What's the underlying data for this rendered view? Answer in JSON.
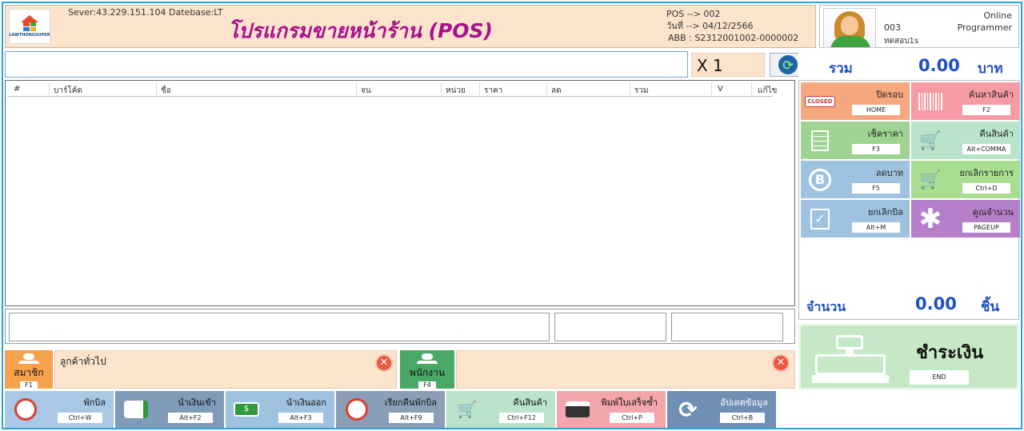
{
  "header": {
    "logo_text": "LAWTHONGSUPER",
    "server_info": "Sever:43.229.151.104 Datebase:LT",
    "title": "โปรแกรมขายหน้าร้าน (POS)",
    "pos": "POS --> 002",
    "date": "วันที่ --> 04/12/2566",
    "abb": "ABB : S2312001002-0000002"
  },
  "user": {
    "status": "Online",
    "id": "003",
    "role": "Programmer",
    "name": "ทดสอบ1s"
  },
  "entry": {
    "barcode_value": "",
    "qty": "X 1"
  },
  "totals": {
    "sum_label": "รวม",
    "sum_value": "0.00",
    "sum_unit": "บาท",
    "qty_label": "จำนวน",
    "qty_value": "0.00",
    "qty_unit": "ชิ้น"
  },
  "grid": {
    "columns": [
      "#",
      "บาร์โค้ด",
      "ชื่อ",
      "จน",
      "หน่วย",
      "ราคา",
      "ลด",
      "รวม",
      "V",
      "แก้ไข"
    ]
  },
  "functions": [
    {
      "label": "ปิดรอบ",
      "key": "HOME",
      "icon": "closed-sign-icon",
      "color": "#f6a77e"
    },
    {
      "label": "ค้นหาสินค้า",
      "key": "F2",
      "icon": "barcode-icon",
      "color": "#f59ba3"
    },
    {
      "label": "เช็คราคา",
      "key": "F3",
      "icon": "clipboard-icon",
      "color": "#9fd391"
    },
    {
      "label": "คืนสินค้า",
      "key": "Alt+COMMA",
      "icon": "cart-return-icon",
      "color": "#b9e4c9"
    },
    {
      "label": "ลดบาท",
      "key": "F5",
      "icon": "baht-coin-icon",
      "color": "#9fc2e0"
    },
    {
      "label": "ยกเลิกรายการ",
      "key": "Ctrl+D",
      "icon": "cart-cancel-icon",
      "color": "#a9dd8f"
    },
    {
      "label": "ยกเลิกบิล",
      "key": "Alt+M",
      "icon": "clipboard-check-icon",
      "color": "#9fc2e0"
    },
    {
      "label": "คูณจำนวน",
      "key": "PAGEUP",
      "icon": "asterisk-icon",
      "color": "#b57fc9"
    }
  ],
  "pay": {
    "label": "ชำระเงิน",
    "key": "END"
  },
  "member": {
    "button_label": "สมาชิก",
    "key": "F1",
    "name": "ลูกค้าทั่วไป"
  },
  "employee": {
    "button_label": "พนักงาน",
    "key": "F4",
    "name": ""
  },
  "toolbar": [
    {
      "label": "พักบิล",
      "key": "Ctrl+W",
      "icon": "timer-icon",
      "color": "#a9c8e6"
    },
    {
      "label": "นำเงินเข้า",
      "key": "Alt+F2",
      "icon": "wallet-in-icon",
      "color": "#7f9bb8"
    },
    {
      "label": "นำเงินออก",
      "key": "Alt+F3",
      "icon": "money-out-icon",
      "color": "#9fc2e0"
    },
    {
      "label": "เรียกคืนพักบิล",
      "key": "Alt+F9",
      "icon": "timer-return-icon",
      "color": "#8a9fb6"
    },
    {
      "label": "คืนสินค้า",
      "key": "Ctrl+F12",
      "icon": "cart-return-icon",
      "color": "#b9e4c9"
    },
    {
      "label": "พิมพ์ใบเสร็จซ้ำ",
      "key": "Ctrl+P",
      "icon": "printer-icon",
      "color": "#f2a5aa"
    },
    {
      "label": "อัปเดตข้อมูล",
      "key": "Ctrl+B",
      "icon": "refresh-icon",
      "color": "#6f8fb3"
    }
  ]
}
